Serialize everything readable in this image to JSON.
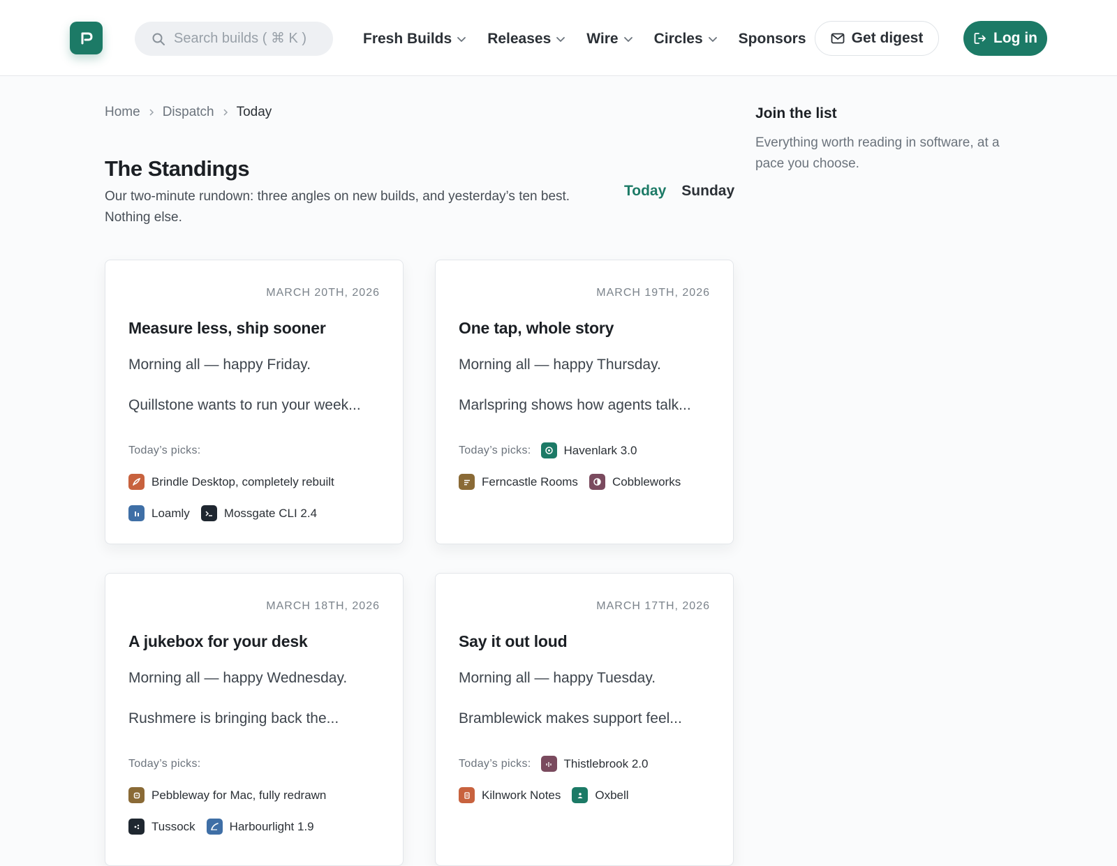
{
  "header": {
    "search_placeholder": "Search builds ( ⌘ K )",
    "nav": [
      {
        "label": "Fresh Builds",
        "dropdown": true
      },
      {
        "label": "Releases",
        "dropdown": true
      },
      {
        "label": "Wire",
        "dropdown": true
      },
      {
        "label": "Circles",
        "dropdown": true
      },
      {
        "label": "Sponsors",
        "dropdown": false
      }
    ],
    "digest_label": "Get digest",
    "login_label": "Log in"
  },
  "colors": {
    "brand": "#1c7a66",
    "text_dark": "#1b1f24",
    "text_muted": "#6b737c"
  },
  "breadcrumb": {
    "items": [
      "Home",
      "Dispatch",
      "Today"
    ]
  },
  "page": {
    "title": "The Standings",
    "description": "Our two-minute rundown: three angles on new builds, and yesterday’s ten best. Nothing else.",
    "tabs": [
      {
        "label": "Today",
        "active": true
      },
      {
        "label": "Sunday",
        "active": false
      }
    ]
  },
  "sidebar": {
    "title": "Join the list",
    "description": "Everything worth reading in software, at a pace you choose."
  },
  "cards": [
    {
      "date": "March 20th, 2026",
      "title": "Measure less, ship sooner",
      "greeting": "Morning all — happy Friday.",
      "teaser": "Quillstone wants to run your week...",
      "picks_label": "Today’s picks:",
      "picks": [
        {
          "name": "Brindle Desktop, completely rebuilt",
          "color": "#c8623e",
          "icon": "feather-icon"
        },
        {
          "name": "Loamly",
          "color": "#3f6fa6",
          "icon": "bars-icon"
        },
        {
          "name": "Mossgate CLI 2.4",
          "color": "#1f2730",
          "icon": "terminal-icon"
        }
      ]
    },
    {
      "date": "March 19th, 2026",
      "title": "One tap, whole story",
      "greeting": "Morning all — happy Thursday.",
      "teaser": "Marlspring shows how agents talk...",
      "picks_label": "Today’s picks:",
      "picks": [
        {
          "name": "Havenlark 3.0",
          "color": "#1c7a66",
          "icon": "target-icon"
        },
        {
          "name": "Ferncastle Rooms",
          "color": "#8a6a36",
          "icon": "lines-icon"
        },
        {
          "name": "Cobbleworks",
          "color": "#7a4a5e",
          "icon": "half-circle-icon"
        }
      ]
    },
    {
      "date": "March 18th, 2026",
      "title": "A jukebox for your desk",
      "greeting": "Morning all — happy Wednesday.",
      "teaser": "Rushmere is bringing back the...",
      "picks_label": "Today’s picks:",
      "picks": [
        {
          "name": "Pebbleway for Mac, fully redrawn",
          "color": "#8a6a36",
          "icon": "square-icon"
        },
        {
          "name": "Tussock",
          "color": "#1f2730",
          "icon": "dots-icon"
        },
        {
          "name": "Harbourlight 1.9",
          "color": "#3f6fa6",
          "icon": "feather-icon"
        }
      ]
    },
    {
      "date": "March 17th, 2026",
      "title": "Say it out loud",
      "greeting": "Morning all — happy Tuesday.",
      "teaser": "Bramblewick makes support feel...",
      "picks_label": "Today’s picks:",
      "picks": [
        {
          "name": "Thistlebrook 2.0",
          "color": "#7a4a5e",
          "icon": "waveform-icon"
        },
        {
          "name": "Kilnwork Notes",
          "color": "#c8623e",
          "icon": "note-icon"
        },
        {
          "name": "Oxbell",
          "color": "#1c7a66",
          "icon": "person-icon"
        }
      ]
    }
  ]
}
